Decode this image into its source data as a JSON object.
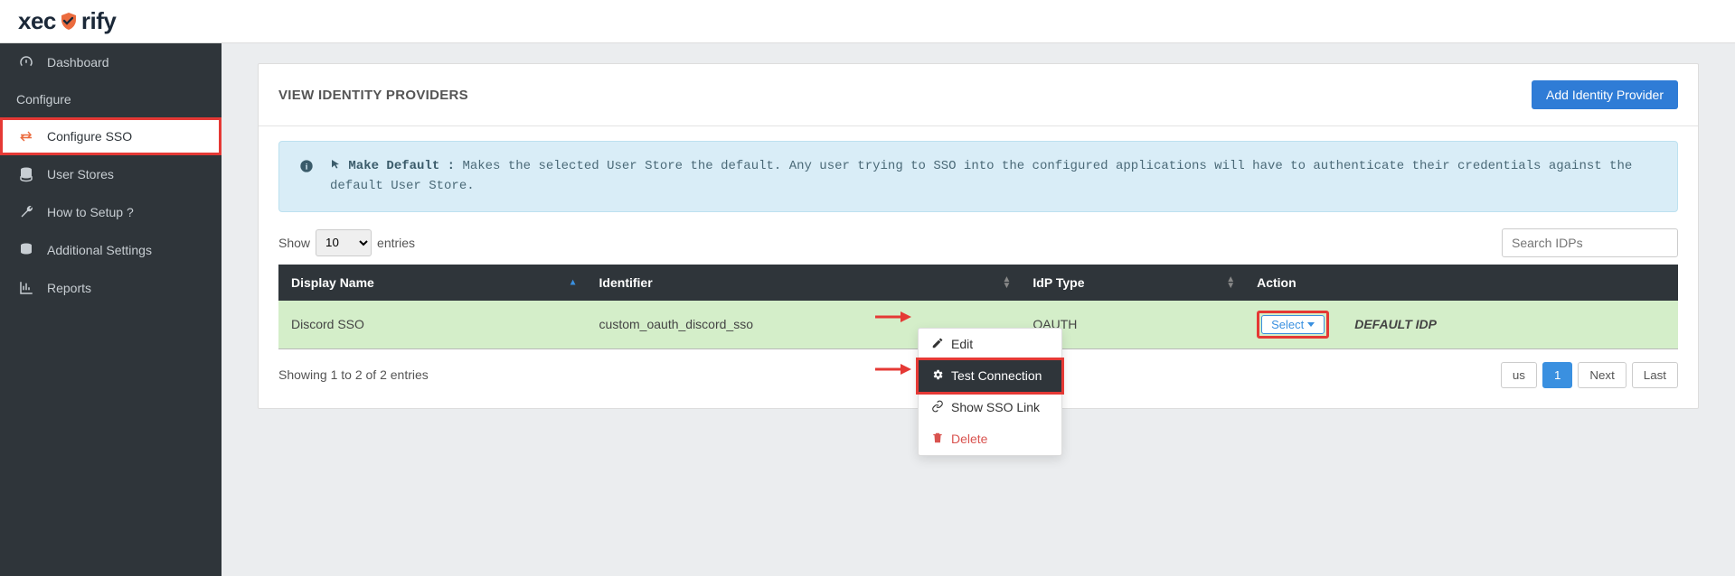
{
  "logo_pre": "xec",
  "logo_post": "rify",
  "sidebar": {
    "items": [
      {
        "label": "Dashboard"
      },
      {
        "label": "Configure"
      },
      {
        "label": "Configure SSO"
      },
      {
        "label": "User Stores"
      },
      {
        "label": "How to Setup ?"
      },
      {
        "label": "Additional Settings"
      },
      {
        "label": "Reports"
      }
    ]
  },
  "page": {
    "title": "VIEW IDENTITY PROVIDERS",
    "add_btn": "Add Identity Provider"
  },
  "info": {
    "label": "Make Default :",
    "text": "Makes the selected User Store the default. Any user trying to SSO into the configured applications will have to authenticate their credentials against the default User Store."
  },
  "table": {
    "show_label_pre": "Show",
    "show_label_post": "entries",
    "show_value": "10",
    "search_placeholder": "Search IDPs",
    "cols": {
      "display_name": "Display Name",
      "identifier": "Identifier",
      "idp_type": "IdP Type",
      "action": "Action"
    },
    "rows": [
      {
        "display_name": "Discord SSO",
        "identifier": "custom_oauth_discord_sso",
        "idp_type": "OAUTH",
        "action_label": "Select",
        "badge": "DEFAULT IDP"
      }
    ],
    "footer": "Showing 1 to 2 of 2 entries",
    "pagination": {
      "previous": "us",
      "page1": "1",
      "next": "Next",
      "last": "Last"
    }
  },
  "dropdown": {
    "edit": "Edit",
    "test": "Test Connection",
    "show_link": "Show SSO Link",
    "delete": "Delete"
  }
}
